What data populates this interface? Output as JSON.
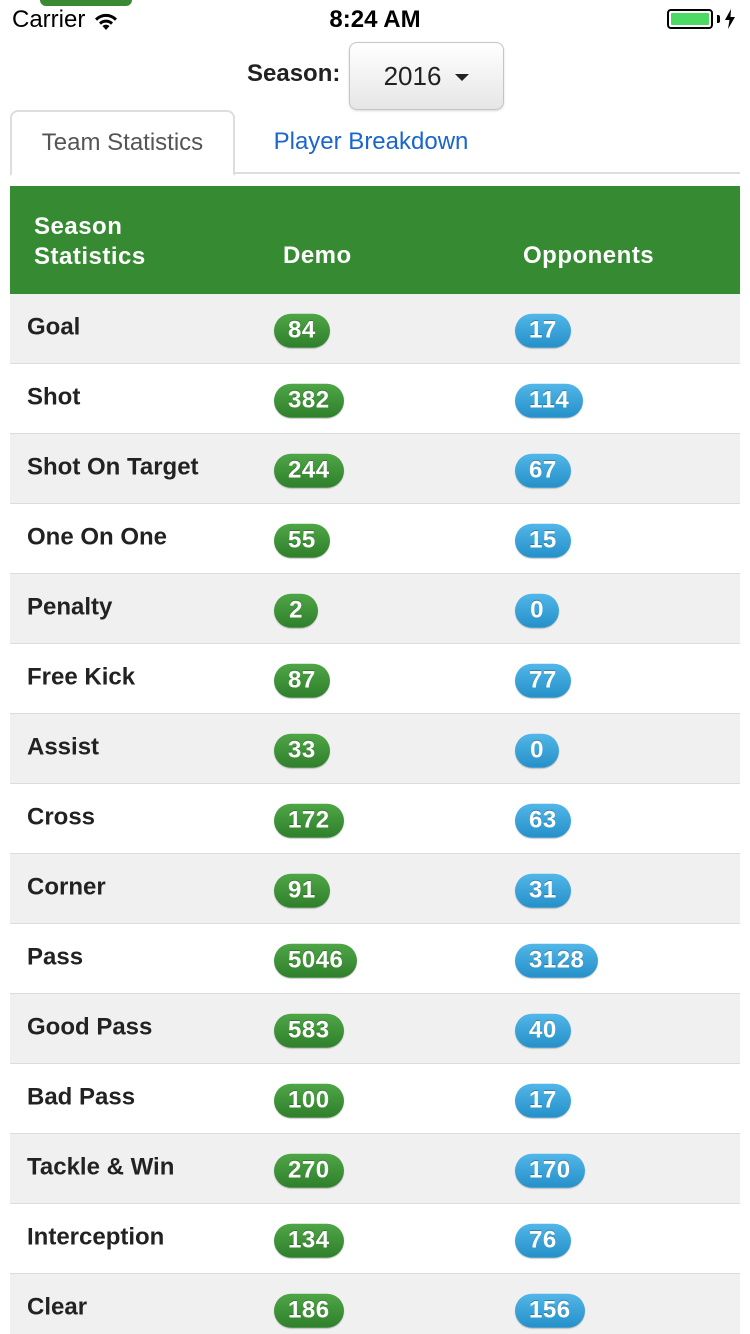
{
  "status_bar": {
    "carrier": "Carrier",
    "time": "8:24 AM",
    "battery_color": "#4cd964",
    "icons": [
      "wifi-icon",
      "battery-icon",
      "charging-bolt-icon"
    ]
  },
  "season": {
    "label": "Season:",
    "selected": "2016"
  },
  "tabs": [
    {
      "label": "Team Statistics",
      "active": true
    },
    {
      "label": "Player Breakdown",
      "active": false
    }
  ],
  "table": {
    "headers": {
      "stat": "Season Statistics",
      "demo": "Demo",
      "opponents": "Opponents"
    },
    "header_color": "#368a32",
    "demo_badge_color": "#3a9634",
    "opponents_badge_color": "#31a3dc",
    "rows": [
      {
        "label": "Goal",
        "demo": "84",
        "opponents": "17"
      },
      {
        "label": "Shot",
        "demo": "382",
        "opponents": "114"
      },
      {
        "label": "Shot On Target",
        "demo": "244",
        "opponents": "67"
      },
      {
        "label": "One On One",
        "demo": "55",
        "opponents": "15"
      },
      {
        "label": "Penalty",
        "demo": "2",
        "opponents": "0"
      },
      {
        "label": "Free Kick",
        "demo": "87",
        "opponents": "77"
      },
      {
        "label": "Assist",
        "demo": "33",
        "opponents": "0"
      },
      {
        "label": "Cross",
        "demo": "172",
        "opponents": "63"
      },
      {
        "label": "Corner",
        "demo": "91",
        "opponents": "31"
      },
      {
        "label": "Pass",
        "demo": "5046",
        "opponents": "3128"
      },
      {
        "label": "Good Pass",
        "demo": "583",
        "opponents": "40"
      },
      {
        "label": "Bad Pass",
        "demo": "100",
        "opponents": "17"
      },
      {
        "label": "Tackle & Win",
        "demo": "270",
        "opponents": "170"
      },
      {
        "label": "Interception",
        "demo": "134",
        "opponents": "76"
      },
      {
        "label": "Clear",
        "demo": "186",
        "opponents": "156"
      }
    ]
  }
}
